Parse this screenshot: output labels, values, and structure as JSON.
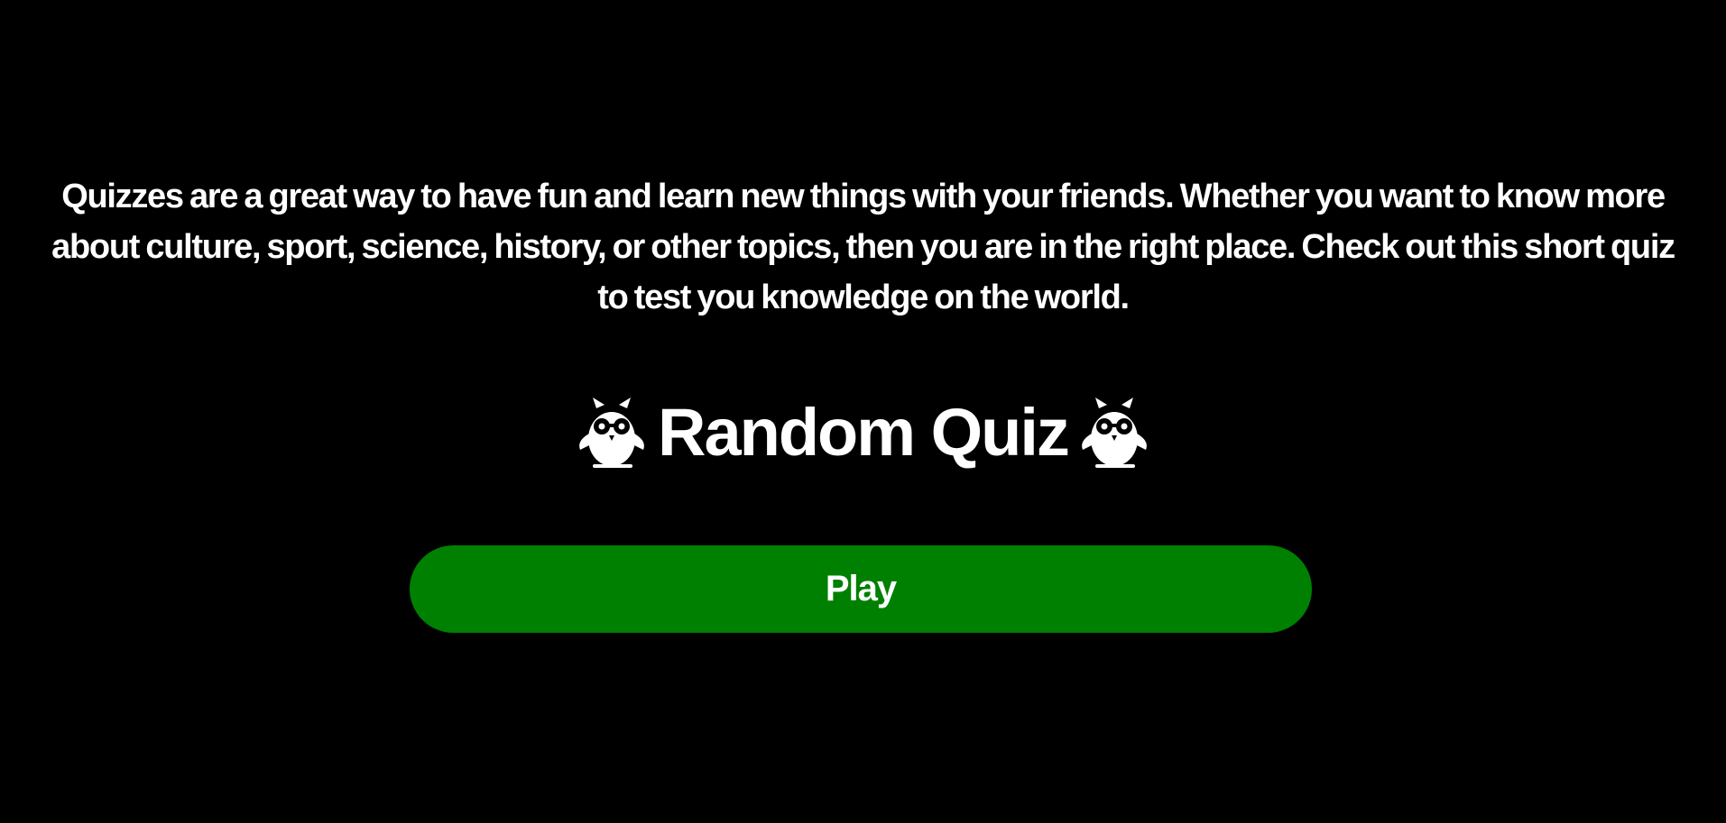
{
  "intro": {
    "text": "Quizzes are a great way to have fun and learn new things with your friends. Whether you want to know more about culture, sport, science, history, or other topics, then you are in the right place. Check out this short quiz to test you knowledge on the world."
  },
  "title": {
    "text": "Random Quiz",
    "left_icon": "owl-with-glasses-icon",
    "right_icon": "owl-with-glasses-icon"
  },
  "play_button": {
    "label": "Play",
    "color": "#008000"
  },
  "colors": {
    "background": "#000000",
    "text": "#ffffff",
    "accent": "#008000"
  }
}
